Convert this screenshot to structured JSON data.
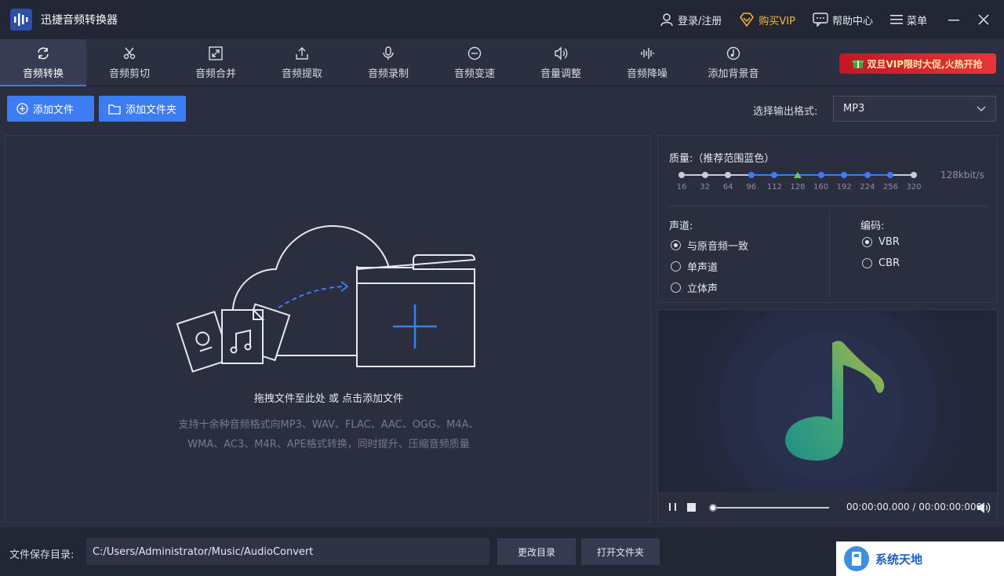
{
  "app": {
    "title": "迅捷音频转换器"
  },
  "header": {
    "login": "登录/注册",
    "vip": "购买VIP",
    "help": "帮助中心",
    "menu": "菜单"
  },
  "tabs": [
    {
      "label": "音频转换",
      "icon": "convert-icon",
      "active": true
    },
    {
      "label": "音频剪切",
      "icon": "scissors-icon"
    },
    {
      "label": "音频合并",
      "icon": "merge-icon"
    },
    {
      "label": "音频提取",
      "icon": "extract-icon"
    },
    {
      "label": "音频录制",
      "icon": "microphone-icon"
    },
    {
      "label": "音频变速",
      "icon": "speed-icon"
    },
    {
      "label": "音量调整",
      "icon": "volume-icon"
    },
    {
      "label": "音频降噪",
      "icon": "denoise-icon"
    },
    {
      "label": "添加背景音",
      "icon": "background-music-icon"
    }
  ],
  "promo": {
    "text": "双旦VIP限时大促,火热开抢"
  },
  "toolbar": {
    "add_file": "添加文件",
    "add_folder": "添加文件夹",
    "format_label": "选择输出格式:",
    "format_value": "MP3"
  },
  "dropzone": {
    "main": "拖拽文件至此处 或 点击添加文件",
    "sub1": "支持十余种音频格式向MP3、WAV、FLAC、AAC、OGG、M4A、",
    "sub2": "WMA、AC3、M4R、APE格式转换，同时提升、压缩音频质量"
  },
  "settings": {
    "quality_label": "质量:（推荐范围蓝色）",
    "quality_ticks": [
      "16",
      "32",
      "64",
      "96",
      "112",
      "128",
      "160",
      "192",
      "224",
      "256",
      "320"
    ],
    "quality_selected": "128",
    "quality_value": "128kbit/s",
    "channel_label": "声道:",
    "channel_options": [
      "与原音频一致",
      "单声道",
      "立体声"
    ],
    "channel_selected": "与原音频一致",
    "encoding_label": "编码:",
    "encoding_options": [
      "VBR",
      "CBR"
    ],
    "encoding_selected": "VBR"
  },
  "player": {
    "time": "00:00:00.000 / 00:00:00:000",
    "progress": 0
  },
  "bottom": {
    "save_label": "文件保存目录:",
    "save_path": "C:/Users/Administrator/Music/AudioConvert",
    "change_dir": "更改目录",
    "open_folder": "打开文件夹"
  },
  "watermark": {
    "text": "系统天地"
  },
  "colors": {
    "accent": "#3d7cf5",
    "vip": "#f5b73a",
    "promo": "#d42a30",
    "background": "#2a2e3e"
  }
}
